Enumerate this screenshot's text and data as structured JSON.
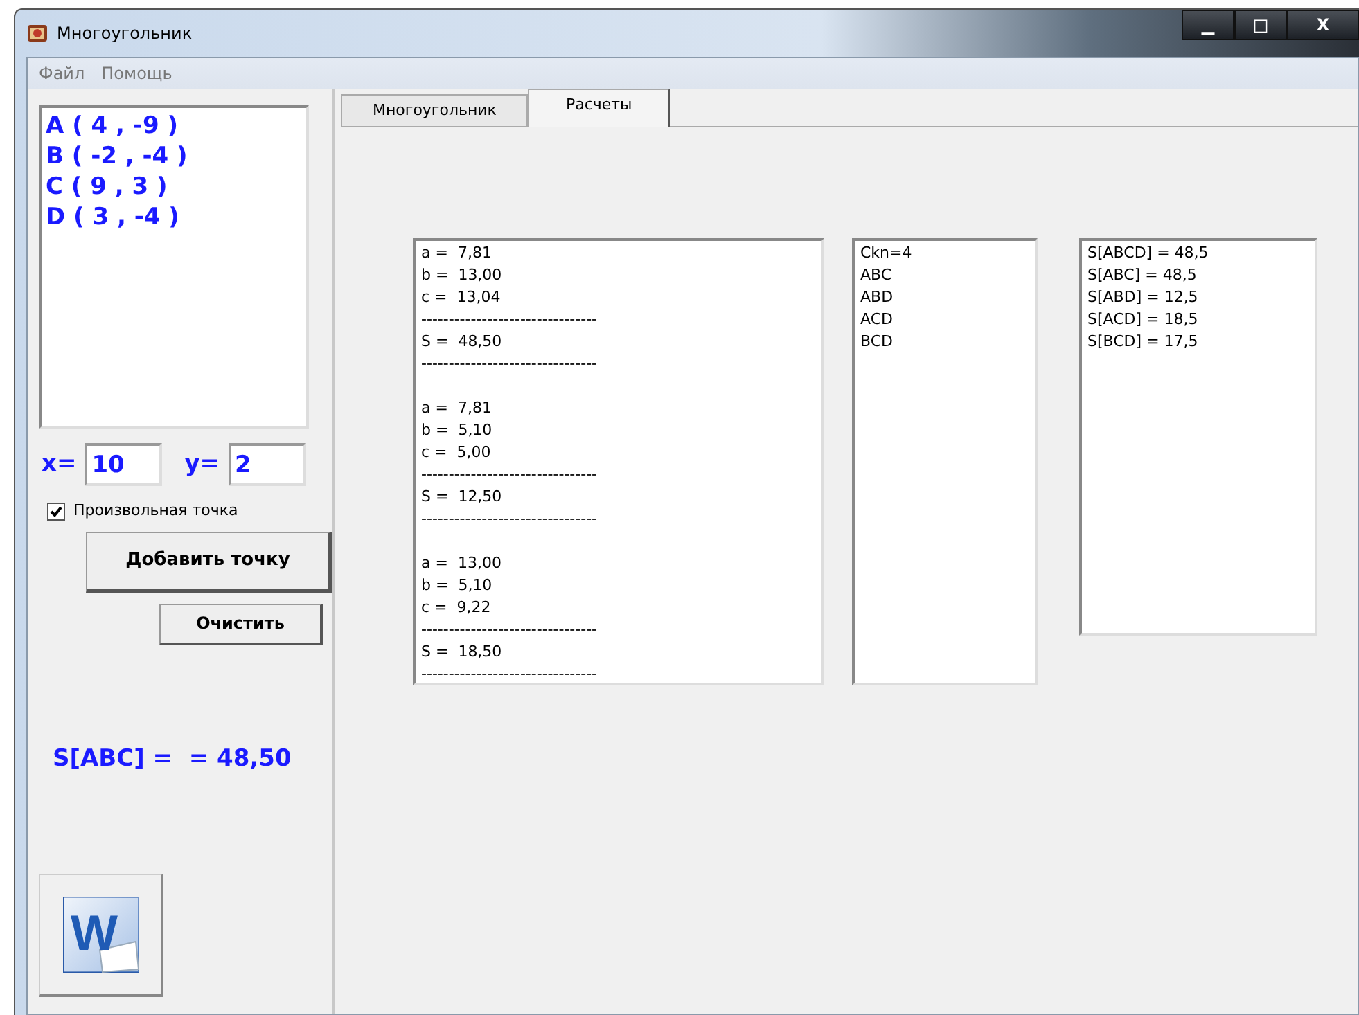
{
  "window": {
    "title": "Многоугольник",
    "controls": [
      "▁",
      "□",
      "X"
    ]
  },
  "menu": [
    "Файл",
    "Помощь"
  ],
  "points": [
    "A ( 4 , -9 )",
    "B ( -2 , -4 )",
    "C ( 9 , 3 )",
    "D ( 3 , -4 )"
  ],
  "x_field": {
    "label": "x=",
    "value": "10"
  },
  "y_field": {
    "label": "y=",
    "value": "2"
  },
  "arbitrary_point": {
    "label": "Произвольная точка",
    "checked": true
  },
  "add_button": "Добавить точку",
  "clear_button": "Очистить",
  "result": "S[ABC] =  = 48,50",
  "word_button": {
    "label": "W"
  },
  "tabs": [
    {
      "label": "Многоугольник",
      "selected": false
    },
    {
      "label": "Расчеты",
      "selected": true
    }
  ],
  "triangles": [
    [
      "a =  7,81",
      "b =  13,00",
      "c =  13,04",
      "--------------------------------",
      "S =  48,50",
      "--------------------------------"
    ],
    [
      "a =  7,81",
      "b =  5,10",
      "c =  5,00",
      "--------------------------------",
      "S =  12,50",
      "--------------------------------"
    ],
    [
      "a =  13,00",
      "b =  5,10",
      "c =  9,22",
      "--------------------------------",
      "S =  18,50",
      "--------------------------------"
    ]
  ],
  "combinations": [
    "Ckn=4",
    "ABC",
    "ABD",
    "ACD",
    "BCD"
  ],
  "areas": [
    "S[ABCD] = 48,5",
    "S[ABC] = 48,5",
    "S[ABD] = 12,5",
    "S[ACD] = 18,5",
    "S[BCD] = 17,5"
  ]
}
